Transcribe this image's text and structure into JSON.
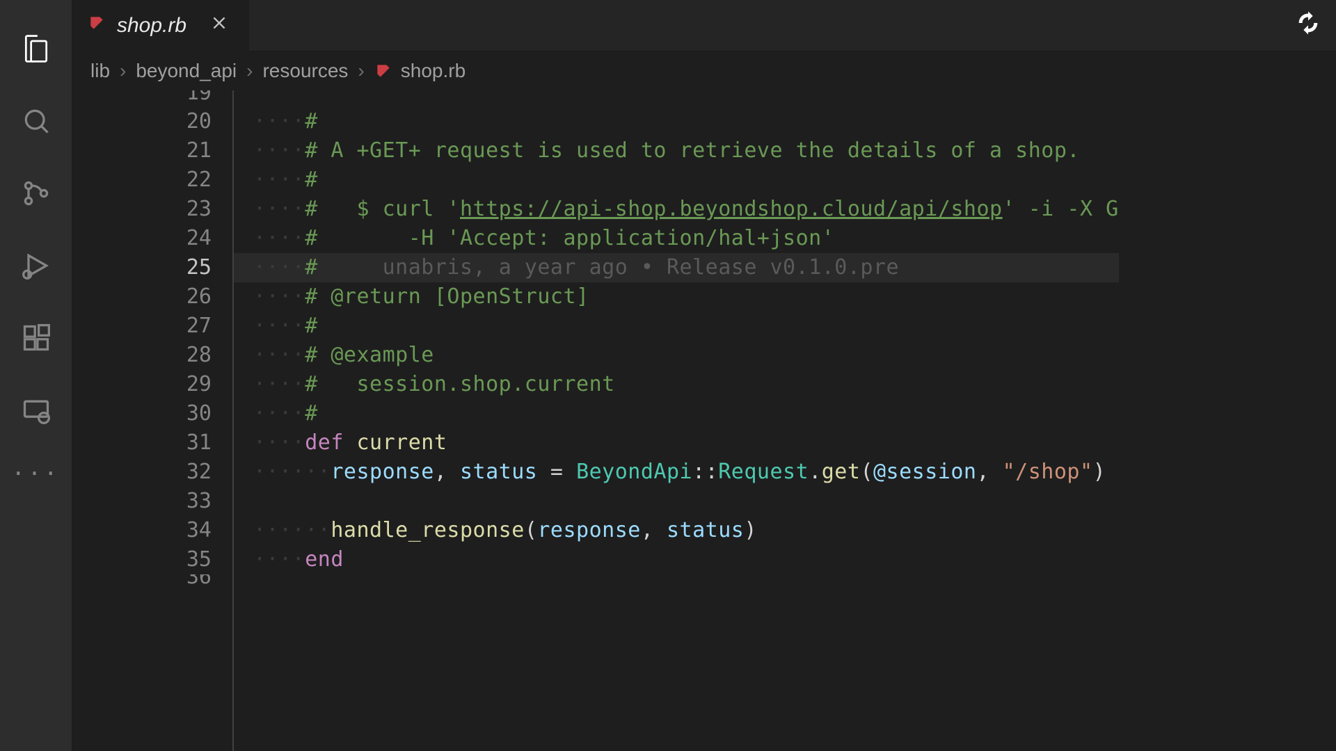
{
  "tab": {
    "label": "shop.rb",
    "icon_name": "ruby-icon"
  },
  "breadcrumbs": {
    "items": [
      "lib",
      "beyond_api",
      "resources",
      "shop.rb"
    ],
    "sep": "›"
  },
  "gutter": {
    "start": 19,
    "end": 36
  },
  "active_line": 25,
  "blame": {
    "author": "unabris",
    "when": "a year ago",
    "message": "Release v0.1.0.pre"
  },
  "code": {
    "l20": "#",
    "l21_a": "# A ",
    "l21_get": "+GET+",
    "l21_b": " request is used to retrieve the details of a shop.",
    "l22": "#",
    "l23_a": "#   $ curl '",
    "l23_url": "https://api-shop.beyondshop.cloud/api/shop",
    "l23_b": "' -i -X G",
    "l24": "#       -H 'Accept: application/hal+json'",
    "l25": "#",
    "l26": "# @return [OpenStruct]",
    "l27": "#",
    "l28": "# @example",
    "l29": "#   session.shop.current",
    "l30": "#",
    "def": "def",
    "current": "current",
    "response": "response",
    "status": "status",
    "BeyondApi": "BeyondApi",
    "Request": "Request",
    "get": "get",
    "session_ivar": "@session",
    "shop_str": "\"/shop\"",
    "handle_response": "handle_response",
    "end": "end"
  }
}
